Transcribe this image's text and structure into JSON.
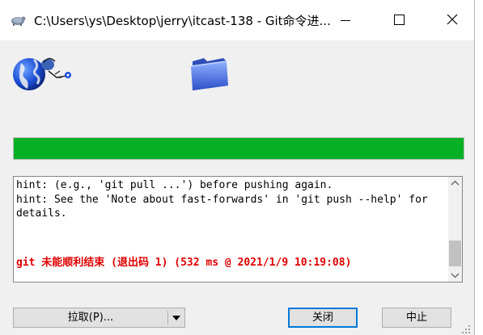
{
  "window": {
    "title": "C:\\Users\\ys\\Desktop\\jerry\\itcast-138 - Git命令进..."
  },
  "progress": {
    "value": 1.0,
    "color": "#06b025"
  },
  "log": {
    "lines": [
      "hint: (e.g., 'git pull ...') before pushing again.",
      "hint: See the 'Note about fast-forwards' in 'git push --help' for",
      "details."
    ],
    "error": "git 未能顺利结束 (退出码 1) (532 ms @ 2021/1/9 10:19:08)",
    "error_color": "#e00000"
  },
  "buttons": {
    "pull": "拉取(P)...",
    "close": "关闭",
    "abort": "中止"
  },
  "icons": {
    "title": "tortoisegit-icon",
    "globe": "remote-globe-icon",
    "folder": "local-folder-icon"
  }
}
